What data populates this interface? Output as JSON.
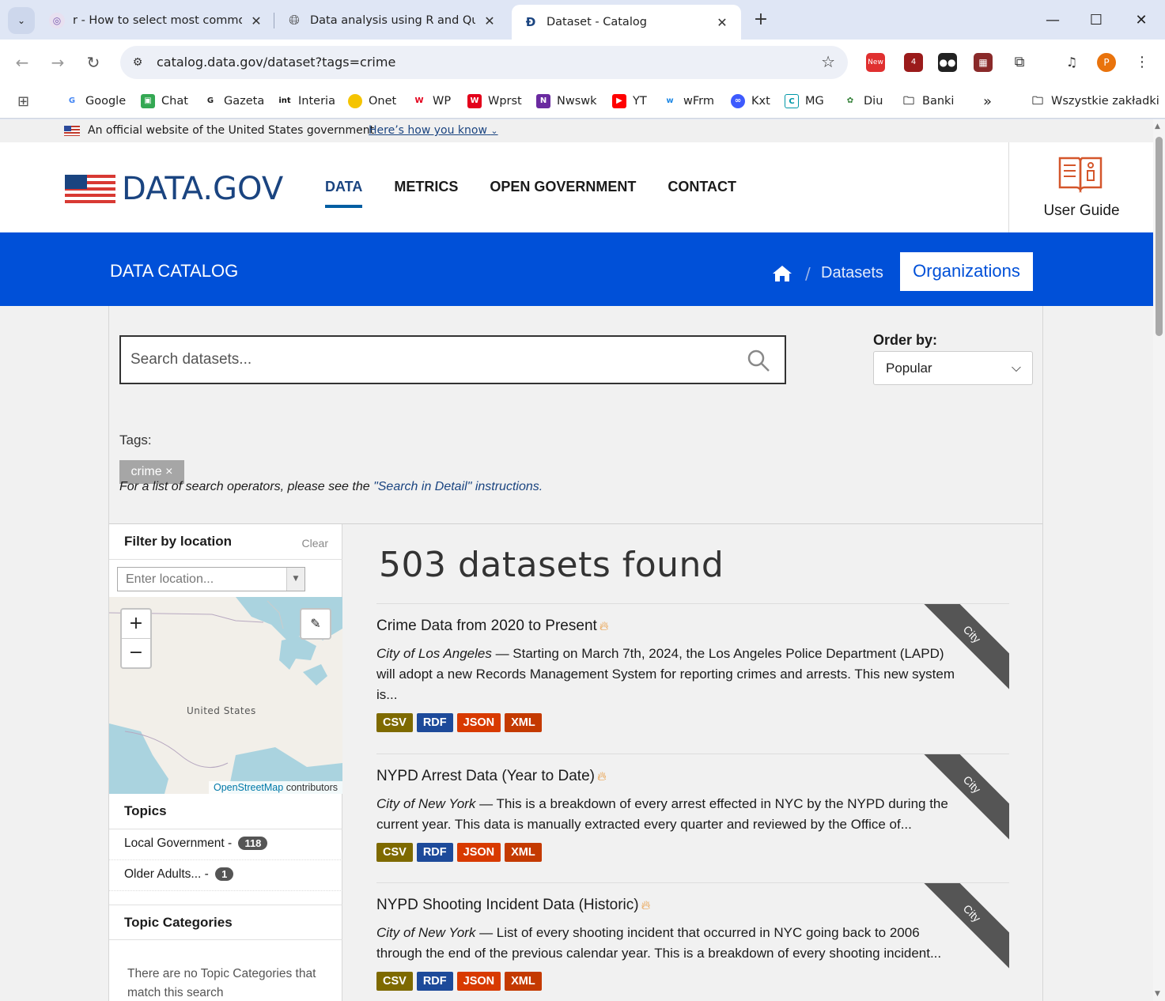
{
  "browser": {
    "tabs": [
      {
        "title": "r - How to select most common",
        "active": false
      },
      {
        "title": "Data analysis using R and Quart",
        "active": false
      },
      {
        "title": "Dataset - Catalog",
        "active": true
      }
    ],
    "url": "catalog.data.gov/dataset?tags=crime",
    "profile_initial": "P",
    "extension_new_badge": "New",
    "extension_count_badge": "4",
    "bookmarks": [
      "Google",
      "Chat",
      "Gazeta",
      "Interia",
      "Onet",
      "WP",
      "Wprst",
      "Nwswk",
      "YT",
      "wFrm",
      "Kxt",
      "MG",
      "Diu",
      "Banki"
    ],
    "bookmarks_all": "Wszystkie zakładki"
  },
  "gov_banner": {
    "text": "An official website of the United States government",
    "link": "Here’s how you know"
  },
  "header": {
    "logo": "DATA.GOV",
    "nav": [
      "DATA",
      "METRICS",
      "OPEN GOVERNMENT",
      "CONTACT"
    ],
    "active_nav": "DATA",
    "user_guide": "User Guide"
  },
  "catalog_bar": {
    "title": "DATA CATALOG",
    "breadcrumb_datasets": "Datasets",
    "organizations": "Organizations"
  },
  "search": {
    "placeholder": "Search datasets...",
    "order_label": "Order by:",
    "order_value": "Popular",
    "tags_label": "Tags:",
    "tag": "crime ×",
    "instructions_prefix": "For a list of search operators, please see the ",
    "instructions_link": "\"Search in Detail\" instructions."
  },
  "sidebar": {
    "location_heading": "Filter by location",
    "clear": "Clear",
    "location_placeholder": "Enter location...",
    "map_country_label": "United States",
    "map_attribution_link": "OpenStreetMap",
    "map_attribution_text": " contributors",
    "topics_heading": "Topics",
    "topics": [
      {
        "label": "Local Government - ",
        "count": "118"
      },
      {
        "label": "Older Adults... - ",
        "count": "1"
      }
    ],
    "topic_categories_heading": "Topic Categories",
    "no_categories": "There are no Topic Categories that match this search"
  },
  "results": {
    "count_text": "503 datasets found",
    "datasets": [
      {
        "title": "Crime Data from 2020 to Present",
        "publisher": "City of Los Angeles",
        "description": " — Starting on March 7th, 2024, the Los Angeles Police Department (LAPD) will adopt a new Records Management System for reporting crimes and arrests. This new system is...",
        "ribbon": "City",
        "formats": [
          "CSV",
          "RDF",
          "JSON",
          "XML"
        ]
      },
      {
        "title": "NYPD Arrest Data (Year to Date)",
        "publisher": "City of New York",
        "description": " — This is a breakdown of every arrest effected in NYC by the NYPD during the current year. This data is manually extracted every quarter and reviewed by the Office of...",
        "ribbon": "City",
        "formats": [
          "CSV",
          "RDF",
          "JSON",
          "XML"
        ]
      },
      {
        "title": "NYPD Shooting Incident Data (Historic)",
        "publisher": "City of New York",
        "description": " — List of every shooting incident that occurred in NYC going back to 2006 through the end of the previous calendar year. This is a breakdown of every shooting incident...",
        "ribbon": "City",
        "formats": [
          "CSV",
          "RDF",
          "JSON",
          "XML"
        ]
      }
    ]
  },
  "colors": {
    "catalog_bar": "#0050d8",
    "brand_navy": "#1a4480",
    "csv": "#7e6a00",
    "rdf": "#1d4a9a",
    "json": "#d83a00",
    "xml": "#c43a00"
  }
}
